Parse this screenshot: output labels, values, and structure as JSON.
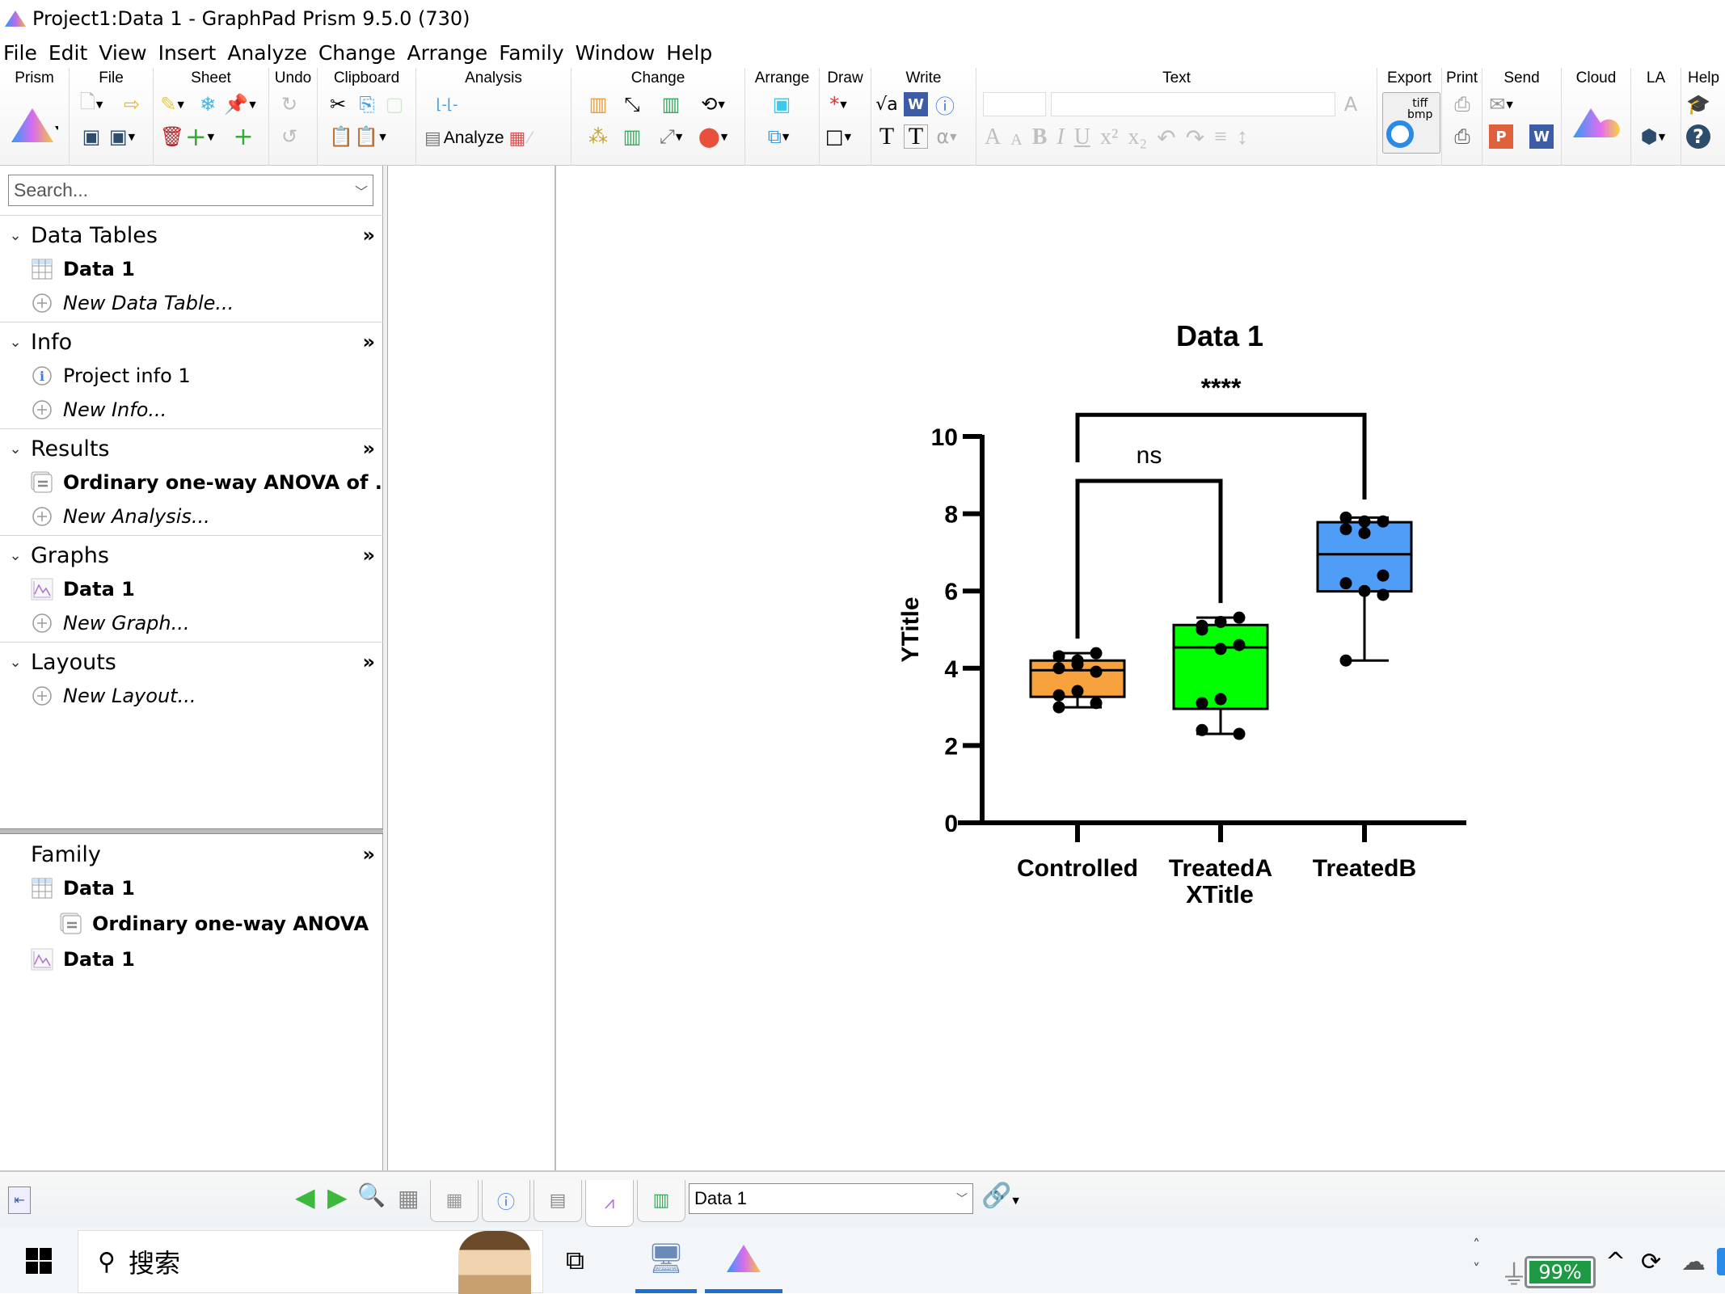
{
  "window": {
    "title": "Project1:Data 1 - GraphPad Prism 9.5.0 (730)"
  },
  "menu": [
    "File",
    "Edit",
    "View",
    "Insert",
    "Analyze",
    "Change",
    "Arrange",
    "Family",
    "Window",
    "Help"
  ],
  "ribbon": {
    "groups": [
      "Prism",
      "File",
      "Sheet",
      "Undo",
      "Clipboard",
      "Analysis",
      "Change",
      "Arrange",
      "Draw",
      "Write",
      "Text",
      "Export",
      "Print",
      "Send",
      "Cloud",
      "LA",
      "Help"
    ],
    "analyze_label": "Analyze",
    "export_tiff_label": "tiff",
    "export_bmp_label": "bmp"
  },
  "navigator": {
    "search_placeholder": "Search...",
    "sections": [
      {
        "title": "Data Tables",
        "items": [
          {
            "label": "Data 1",
            "style": "bold",
            "icon": "table-icon"
          },
          {
            "label": "New Data Table...",
            "style": "italic",
            "icon": "add-circle-icon"
          }
        ]
      },
      {
        "title": "Info",
        "items": [
          {
            "label": "Project info 1",
            "style": "normal",
            "icon": "info-icon"
          },
          {
            "label": "New Info...",
            "style": "italic",
            "icon": "add-circle-icon"
          }
        ]
      },
      {
        "title": "Results",
        "items": [
          {
            "label": "Ordinary one-way ANOVA of ...",
            "style": "bold",
            "icon": "results-icon"
          },
          {
            "label": "New Analysis...",
            "style": "italic",
            "icon": "add-circle-icon"
          }
        ]
      },
      {
        "title": "Graphs",
        "items": [
          {
            "label": "Data 1",
            "style": "bold",
            "icon": "graph-icon"
          },
          {
            "label": "New Graph...",
            "style": "italic",
            "icon": "add-circle-icon"
          }
        ]
      },
      {
        "title": "Layouts",
        "items": [
          {
            "label": "New Layout...",
            "style": "italic",
            "icon": "add-circle-icon"
          }
        ]
      }
    ],
    "more_glyph": "»",
    "family": {
      "title": "Family",
      "items": [
        {
          "label": "Data 1",
          "icon": "table-icon",
          "level": 0
        },
        {
          "label": "Ordinary one-way ANOVA",
          "icon": "results-icon",
          "level": 1
        },
        {
          "label": "Data 1",
          "icon": "graph-icon",
          "level": 0
        }
      ]
    }
  },
  "statusbar": {
    "sheet_select_value": "Data 1"
  },
  "taskbar": {
    "search_label": "搜索",
    "battery_percent": "99%"
  },
  "chart_data": {
    "type": "box",
    "title": "Data 1",
    "xlabel": "XTitle",
    "ylabel": "YTitle",
    "ylim": [
      0,
      10
    ],
    "yticks": [
      0,
      2,
      4,
      6,
      8,
      10
    ],
    "categories": [
      "Controlled",
      "TreatedA",
      "TreatedB"
    ],
    "colors": [
      "#f7a23c",
      "#00ff00",
      "#4f9df7"
    ],
    "boxes": [
      {
        "name": "Controlled",
        "min": 2.99,
        "q1": 3.26,
        "median": 3.95,
        "q3": 4.2,
        "max": 4.39,
        "points": [
          4.31,
          4.2,
          4.39,
          4.0,
          4.1,
          3.91,
          3.3,
          3.41,
          3.1,
          2.99
        ]
      },
      {
        "name": "TreatedA",
        "min": 2.3,
        "q1": 2.95,
        "median": 4.54,
        "q3": 5.12,
        "max": 5.31,
        "points": [
          5.1,
          5.2,
          5.31,
          5.0,
          4.5,
          4.6,
          3.1,
          3.2,
          2.3,
          2.4
        ]
      },
      {
        "name": "TreatedB",
        "min": 4.2,
        "q1": 5.99,
        "median": 6.95,
        "q3": 7.78,
        "max": 7.9,
        "points": [
          7.9,
          7.8,
          7.8,
          7.6,
          7.5,
          6.4,
          6.2,
          6.0,
          5.9,
          4.2
        ]
      }
    ],
    "significance": [
      {
        "from": "Controlled",
        "to": "TreatedA",
        "label": "ns",
        "y": 8.85
      },
      {
        "from": "Controlled",
        "to": "TreatedB",
        "label": "****",
        "y": 10.56
      }
    ],
    "grid": false,
    "legend": "none"
  }
}
